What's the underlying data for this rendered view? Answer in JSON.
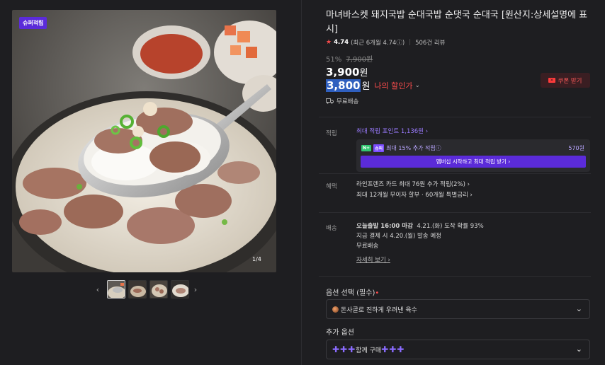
{
  "gallery": {
    "badge": "슈퍼적립",
    "counter": "1/4",
    "prev_icon": "‹",
    "next_icon": "›"
  },
  "product": {
    "title": "마녀바스켓 돼지국밥 순대국밥 순댓국 순대국 [원산지:상세설명에 표시]",
    "rating_star": "★",
    "rating": "4.74",
    "rating_detail": "(최근 6개월 4.74ⓘ)",
    "reviews": "506건 리뷰",
    "discount_rate": "51%",
    "original_price": "7,900원",
    "price": "3,900",
    "price_unit": "원",
    "my_price": "3,800",
    "my_price_unit": "원",
    "my_price_label": "나의 할인가",
    "coupon_label": "쿠폰 받기",
    "free_shipping": "무료배송"
  },
  "points": {
    "label": "적립",
    "max_points": "최대 적립 포인트 1,136원 ›",
    "member_logo1": "N+",
    "member_logo2": "슈퍼",
    "member_text": "최대 15% 추가 적립ⓘ",
    "member_points": "570원",
    "member_button": "멤버십 시작하고 최대 적립 받기 ›"
  },
  "benefits": {
    "label": "혜택",
    "line1": "라인프렌즈 카드 최대 76원 추가 적립(2%) ›",
    "line2": "최대 12개월 무이자 할부 · 60개월 특별금리 ›"
  },
  "delivery": {
    "label": "배송",
    "today": "오늘출발 16:00 마감",
    "arrival": "4.21.(화) 도착 확률 93%",
    "order_now": "지금 결제 시 4.20.(월) 발송 예정",
    "free": "무료배송",
    "detail_link": "자세히 보기 ›"
  },
  "options": {
    "label": "옵션 선택 (필수)",
    "required_mark": "•",
    "selected": "돈사골로 진하게 우려낸 육수",
    "add_label": "추가 옵션",
    "add_plus_left": "✚✚✚",
    "add_value": "함께 구매",
    "add_plus_right": "✚✚✚"
  }
}
